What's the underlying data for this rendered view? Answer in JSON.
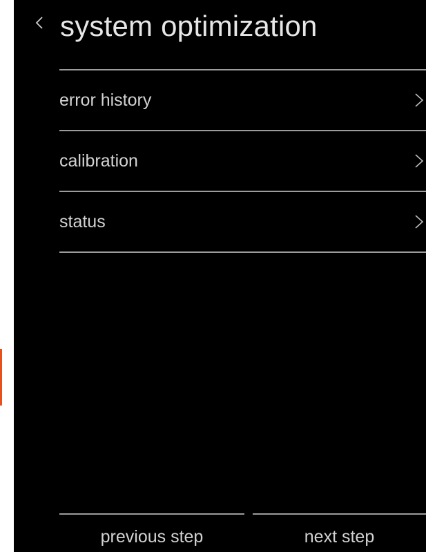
{
  "header": {
    "title": "system optimization",
    "back_icon": "chevron-left-icon"
  },
  "menu": {
    "items": [
      {
        "label": "error history",
        "icon": "chevron-right-icon"
      },
      {
        "label": "calibration",
        "icon": "chevron-right-icon"
      },
      {
        "label": "status",
        "icon": "chevron-right-icon"
      }
    ]
  },
  "footer": {
    "previous_label": "previous step",
    "next_label": "next step"
  },
  "colors": {
    "background": "#000000",
    "text": "#d2d2d2",
    "divider": "#9c9c9c",
    "accent": "#e8501e"
  }
}
